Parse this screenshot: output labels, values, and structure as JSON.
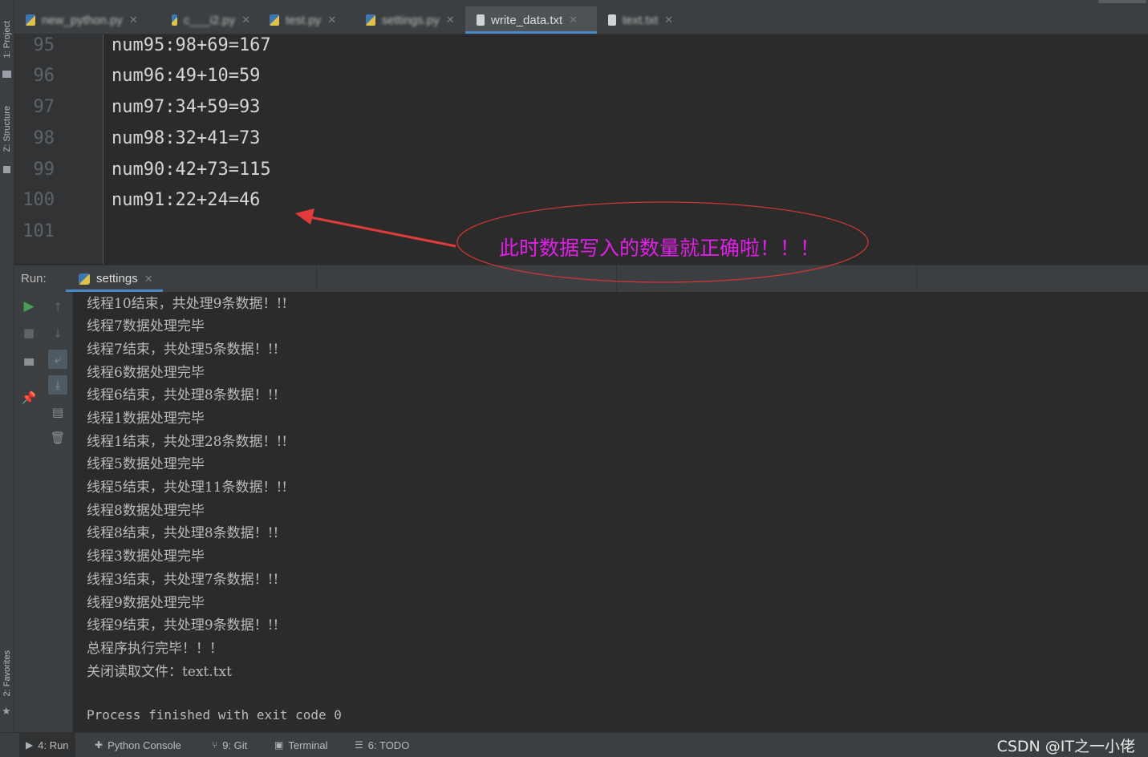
{
  "left_strip": {
    "project_label": "1: Project",
    "structure_label": "Z: Structure",
    "favorites_label": "2: Favorites"
  },
  "editor_tabs": [
    {
      "label": "new_python.py",
      "type": "python",
      "blurred": true
    },
    {
      "label": "c___i2.py",
      "type": "python",
      "blurred": true
    },
    {
      "label": "test.py",
      "type": "python",
      "blurred": true
    },
    {
      "label": "settings.py",
      "type": "python",
      "blurred": true
    },
    {
      "label": "write_data.txt",
      "type": "text",
      "active": true
    },
    {
      "label": "text.txt",
      "type": "text",
      "blurred": true
    }
  ],
  "editor": {
    "line_numbers": [
      "95",
      "96",
      "97",
      "98",
      "99",
      "100",
      "101"
    ],
    "lines": [
      "num95:98+69=167",
      "num96:49+10=59",
      "num97:34+59=93",
      "num98:32+41=73",
      "num90:42+73=115",
      "num91:22+24=46",
      ""
    ]
  },
  "annotation": {
    "text": "此时数据写入的数量就正确啦！！！",
    "color": "#e21fe8",
    "arrow_color": "#e33b3b"
  },
  "run_panel": {
    "label": "Run:",
    "tab_label": "settings"
  },
  "run_tools": {
    "col1": [
      "rerun-icon",
      "stop-icon",
      "layout-icon",
      "pin-icon"
    ],
    "col2": [
      "up-arrow-icon",
      "down-arrow-icon",
      "soft-wrap-icon",
      "scroll-to-end-icon",
      "print-icon",
      "trash-icon"
    ]
  },
  "console": {
    "lines": [
      "线程10结束，共处理9条数据！!!",
      "线程7数据处理完毕",
      "线程7结束，共处理5条数据！!!",
      "线程6数据处理完毕",
      "线程6结束，共处理8条数据！!!",
      "线程1数据处理完毕",
      "线程1结束，共处理28条数据！!!",
      "线程5数据处理完毕",
      "线程5结束，共处理11条数据！!!",
      "线程8数据处理完毕",
      "线程8结束，共处理8条数据！!!",
      "线程3数据处理完毕",
      "线程3结束，共处理7条数据！!!",
      "线程9数据处理完毕",
      "线程9结束，共处理9条数据！!!",
      "总程序执行完毕！！！",
      "关闭读取文件：text.txt",
      "",
      "Process finished with exit code 0"
    ]
  },
  "status_bar": {
    "items": [
      {
        "label": "4: Run",
        "icon": "play-icon",
        "active": true
      },
      {
        "label": "Python Console",
        "icon": "python-icon"
      },
      {
        "label": "9: Git",
        "icon": "git-icon"
      },
      {
        "label": "Terminal",
        "icon": "terminal-icon"
      },
      {
        "label": "6: TODO",
        "icon": "todo-icon"
      }
    ],
    "watermark": "CSDN @IT之一小佬"
  },
  "colors": {
    "accent": "#4a88c7",
    "run_green": "#499c54"
  }
}
